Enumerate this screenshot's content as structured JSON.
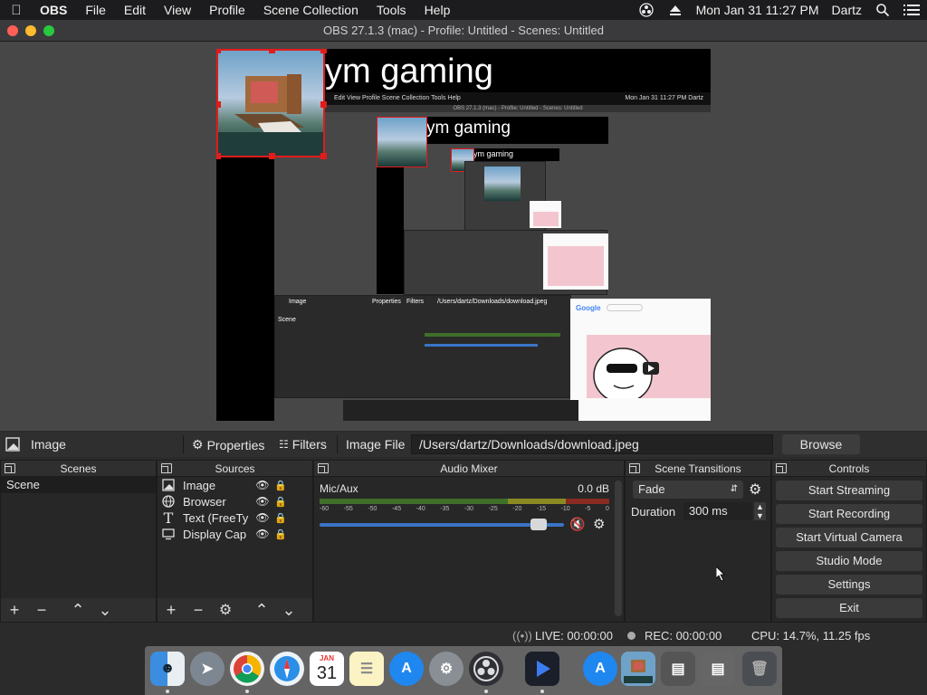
{
  "menubar": {
    "app_name": "OBS",
    "items": [
      "File",
      "Edit",
      "View",
      "Profile",
      "Scene Collection",
      "Tools",
      "Help"
    ],
    "clock": "Mon Jan 31  11:27 PM",
    "user": "Dartz"
  },
  "window": {
    "title": "OBS 27.1.3 (mac) - Profile: Untitled - Scenes: Untitled"
  },
  "preview": {
    "nested_title": "ym gaming",
    "nested_menu": "Edit  View  Profile  Scene Collection  Tools  Help",
    "nested_clock": "Mon Jan 31  11:27 PM  Dartz",
    "nested_subtitle": "OBS 27.1.3 (mac) - Profile: Untitled - Scenes: Untitled"
  },
  "toolbar": {
    "source_name": "Image",
    "properties_label": "Properties",
    "filters_label": "Filters",
    "field_label": "Image File",
    "path_value": "/Users/dartz/Downloads/download.jpeg",
    "browse_label": "Browse"
  },
  "scenes": {
    "header": "Scenes",
    "items": [
      "Scene"
    ]
  },
  "sources": {
    "header": "Sources",
    "items": [
      {
        "name": "Image",
        "icon": "image-icon"
      },
      {
        "name": "Browser",
        "icon": "globe-icon"
      },
      {
        "name": "Text (FreeTy",
        "icon": "text-icon"
      },
      {
        "name": "Display Cap",
        "icon": "monitor-icon"
      }
    ]
  },
  "mixer": {
    "header": "Audio Mixer",
    "channel": "Mic/Aux",
    "level": "0.0 dB",
    "ticks": [
      "-60",
      "-55",
      "-50",
      "-45",
      "-40",
      "-35",
      "-30",
      "-25",
      "-20",
      "-15",
      "-10",
      "-5",
      "0"
    ],
    "volume_fraction": 0.93
  },
  "transitions": {
    "header": "Scene Transitions",
    "selected": "Fade",
    "duration_label": "Duration",
    "duration_value": "300 ms"
  },
  "controls": {
    "header": "Controls",
    "start_streaming": "Start Streaming",
    "start_recording": "Start Recording",
    "start_virtual_camera": "Start Virtual Camera",
    "studio_mode": "Studio Mode",
    "settings": "Settings",
    "exit": "Exit"
  },
  "status": {
    "live": "LIVE: 00:00:00",
    "rec": "REC: 00:00:00",
    "cpu": "CPU: 14.7%, 11.25 fps"
  },
  "dock": {
    "calendar_month": "JAN",
    "calendar_day": "31"
  },
  "colors": {
    "selection_red": "#e21b1b",
    "accent_blue": "#3a74c7",
    "mute_red": "#e22222"
  }
}
